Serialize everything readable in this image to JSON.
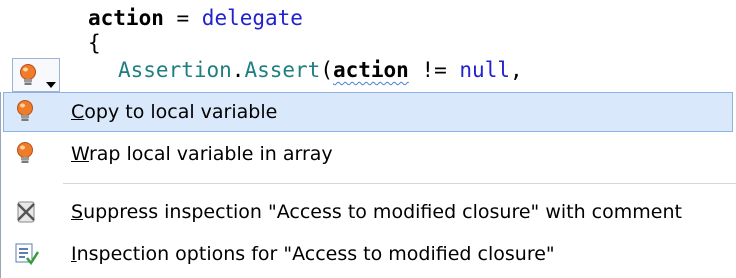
{
  "code": {
    "line1": {
      "var": "action",
      "op": " = ",
      "kw": "delegate"
    },
    "line2": {
      "brace": "{"
    },
    "line3": {
      "class": "Assertion",
      "dot": ".",
      "method": "Assert",
      "open": "(",
      "arg": "action",
      "cmp": " != ",
      "nullkw": "null",
      "tail": ","
    }
  },
  "quickfix_button": {
    "icon": "lightbulb-icon",
    "dropdown_icon": "triangle-down-icon"
  },
  "menu": {
    "items": [
      {
        "mnemonic": "C",
        "rest": "opy to local variable",
        "icon": "lightbulb-icon",
        "selected": true
      },
      {
        "mnemonic": "W",
        "rest": "rap local variable in array",
        "icon": "lightbulb-icon",
        "selected": false
      },
      {
        "mnemonic": "S",
        "rest": "uppress inspection \"Access to modified closure\" with comment",
        "icon": "suppress-icon",
        "selected": false
      },
      {
        "mnemonic": "I",
        "rest": "nspection options for \"Access to modified closure\"",
        "icon": "inspection-options-icon",
        "selected": false
      }
    ]
  },
  "colors": {
    "highlight": "#d9e8fa",
    "highlight_border": "#8db2e3",
    "keyword": "#2121d0",
    "type": "#1f7f80",
    "bulb": "#f07c2a"
  }
}
